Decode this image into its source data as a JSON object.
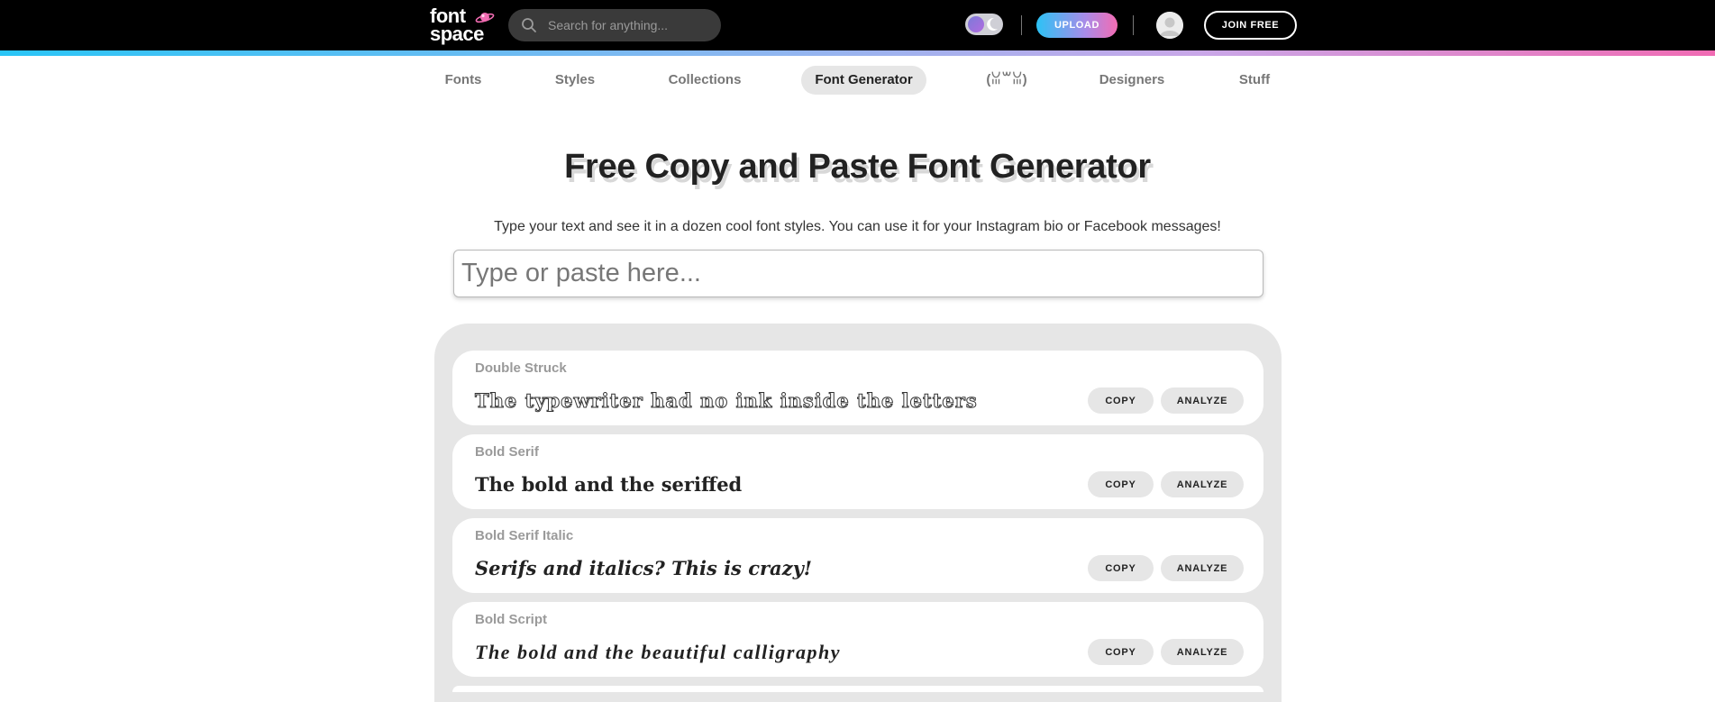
{
  "header": {
    "logo_line1": "font",
    "logo_line2": "space",
    "search_placeholder": "Search for anything...",
    "upload_label": "UPLOAD",
    "join_label": "JOIN FREE",
    "accent_colors": [
      "#29c5f6",
      "#c9a7e8",
      "#f06bb3"
    ]
  },
  "nav": {
    "items": [
      {
        "label": "Fonts"
      },
      {
        "label": "Styles"
      },
      {
        "label": "Collections"
      },
      {
        "label": "Font Generator"
      },
      {
        "label": "(ꈍ꒳ꈍ)"
      },
      {
        "label": "Designers"
      },
      {
        "label": "Stuff"
      }
    ],
    "active": "Font Generator"
  },
  "hero": {
    "title": "Free Copy and Paste Font Generator",
    "subtitle": "Type your text and see it in a dozen cool font styles. You can use it for your Instagram bio or Facebook messages!",
    "input_placeholder": "Type or paste here..."
  },
  "results": {
    "copy_label": "COPY",
    "analyze_label": "ANALYZE",
    "cards": [
      {
        "style": "Double Struck",
        "sample": "The typewriter had no ink inside the letters"
      },
      {
        "style": "Bold Serif",
        "sample": "The bold and the seriffed"
      },
      {
        "style": "Bold Serif Italic",
        "sample": "Serifs and italics? This is crazy!"
      },
      {
        "style": "Bold Script",
        "sample": "The bold and the beautiful calligraphy"
      }
    ]
  }
}
